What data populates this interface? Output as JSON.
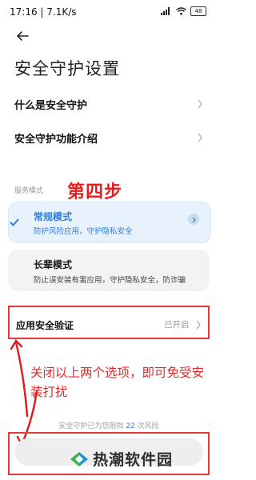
{
  "status_bar": {
    "time_speed": "17:16 | 7.1K/s",
    "battery": "48"
  },
  "header": {
    "title": "安全守护设置"
  },
  "menu": [
    {
      "label": "什么是安全守护"
    },
    {
      "label": "安全守护功能介绍"
    }
  ],
  "modes": {
    "section_label": "服务模式",
    "normal": {
      "title": "常规模式",
      "subtitle": "防护风险应用，守护隐私安全"
    },
    "elder": {
      "title": "长辈模式",
      "subtitle": "防止误安装有害应用，守护隐私安全，防诈骗"
    }
  },
  "verification": {
    "label": "应用安全验证",
    "status": "已开启"
  },
  "footer": {
    "stats_prefix": "安全守护已为您阻挡",
    "stats_count": "22",
    "stats_suffix": "次风险"
  },
  "annotations": {
    "step": "第四步",
    "note": "关闭以上两个选项，即可免受安装打扰",
    "color": "#e02020"
  },
  "watermark": {
    "text": "热潮软件园"
  },
  "colors": {
    "accent": "#2f7de1",
    "highlight_card": "#e8f2fd"
  }
}
